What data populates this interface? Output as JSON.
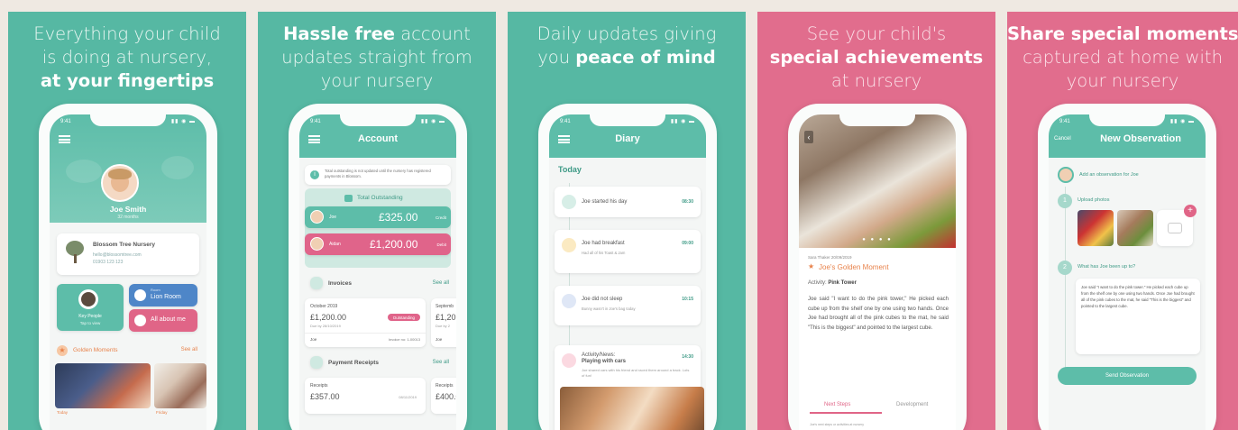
{
  "colors": {
    "teal": "#56b8a3",
    "pink": "#e16d8d",
    "background": "#efe9e2"
  },
  "panel1": {
    "caption": {
      "line1": "Everything your child",
      "line2": "is doing at nursery,",
      "line3_bold": "at your fingertips"
    },
    "phone": {
      "time": "9:41",
      "profile_name": "Joe Smith",
      "profile_age": "32 months",
      "nursery_name": "Blossom Tree Nursery",
      "nursery_email": "hello@blossomtree.com",
      "nursery_phone": "01903 123 123",
      "key_people": "Key People",
      "key_people_sub": "Tap to view",
      "room_label": "Room",
      "room_name": "Lion Room",
      "all_about_me": "All about me",
      "golden_moments": "Golden Moments",
      "see_all": "See all",
      "today": "Today",
      "friday": "Friday"
    }
  },
  "panel2": {
    "caption": {
      "line1_bold": "Hassle free",
      "line1_rest": " account",
      "line2": "updates straight from",
      "line3": "your nursery"
    },
    "phone": {
      "time": "9:41",
      "title": "Account",
      "notice": "Total outstanding is not updated until the nursery has registered payments in Blossom.",
      "total_outstanding": "Total Outstanding",
      "joe_label": "Joe",
      "joe_amount": "£325.00",
      "joe_status": "Credit",
      "aidan_label": "Aidan",
      "aidan_amount": "£1,200.00",
      "aidan_status": "Debit",
      "invoices": "Invoices",
      "see_all": "See all",
      "invoice_month": "October 2019",
      "invoice_amount": "£1,200.00",
      "invoice_due": "Due by 28/10/2019",
      "invoice_badge": "Outstanding",
      "invoice_child": "Joe",
      "invoice_no": "Invoice no: 1-00013",
      "invoice2_month": "Septemb",
      "invoice2_amount": "£1,20",
      "invoice2_due": "Due by 2",
      "invoice2_child": "Joe",
      "payment_receipts": "Payment Receipts",
      "see_all2": "See all",
      "receipts": "Receipts",
      "receipt_amount": "£357.00",
      "receipt_date": "08/11/2019",
      "receipt2_label": "Receipts",
      "receipt2_amount": "£400.0"
    }
  },
  "panel3": {
    "caption": {
      "line1": "Daily updates giving",
      "line2_start": "you ",
      "line2_bold": "peace of mind"
    },
    "phone": {
      "time": "9:41",
      "title": "Diary",
      "today": "Today",
      "entries": [
        {
          "title": "Joe started his day",
          "sub": "",
          "time": "08:30"
        },
        {
          "title": "Joe had breakfast",
          "sub": "Had all of his Toast & Jam",
          "time": "09:00"
        },
        {
          "title": "Joe did not sleep",
          "sub": "Bunny wasn't in Joe's bag today",
          "time": "10:15"
        },
        {
          "title": "Activity/News:",
          "title2": "Playing with cars",
          "sub": "Joe shared cars with his friend and raced them around a track. Lots of fun!",
          "time": "14:30"
        }
      ]
    }
  },
  "panel4": {
    "caption": {
      "line1": "See your child's",
      "line2_bold": "special achievements",
      "line3": "at nursery"
    },
    "phone": {
      "meta": "Sara Thaker 20/09/2019",
      "moment_title": "Joe's Golden Moment",
      "activity_label": "Activity:",
      "activity_value": "Pink Tower",
      "body": "Joe said \"I want to do the pink tower,\" He picked each cube up from the shelf one by one using two hands. Once Joe had brought all of the pink cubes to the mat, he said \"This is the biggest\" and pointed to the largest cube.",
      "tab_next_steps": "Next Steps",
      "tab_development": "Development",
      "footer": "Joe's next steps or activities at nursery"
    }
  },
  "panel5": {
    "caption": {
      "line1_bold": "Share special moments",
      "line2": "captured at home with",
      "line3": "your nursery"
    },
    "phone": {
      "time": "9:41",
      "cancel": "Cancel",
      "title": "New Observation",
      "add_for": "Add an observation for Joe",
      "step1": "1",
      "upload_photos": "Upload photos",
      "step2": "2",
      "question": "What has Joe been up to?",
      "text": "Joe said \"I want to do the pink tower.\" He picked each cube up from the shelf one by one using two hands. Once Joe had brought all of the pink cubes to the mat, he said \"This is the biggest\" and pointed to the largest cube.",
      "send": "Send Observation"
    }
  }
}
